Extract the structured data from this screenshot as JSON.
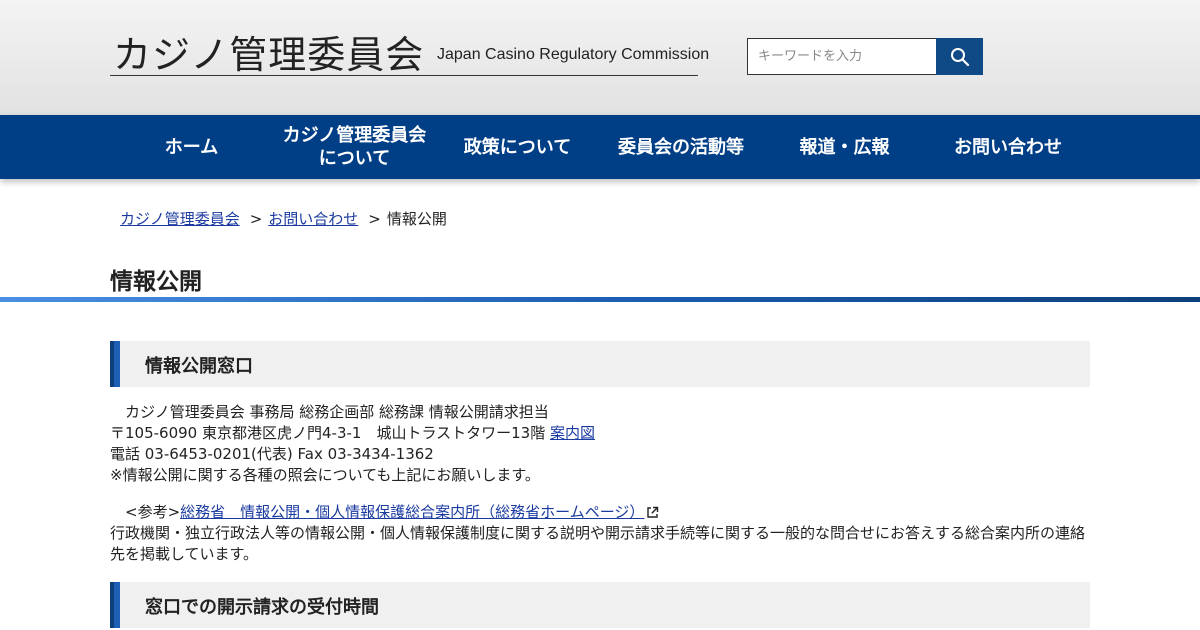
{
  "header": {
    "logo_ja": "カジノ管理委員会",
    "logo_en": "Japan Casino Regulatory Commission",
    "search_placeholder": "キーワードを入力"
  },
  "nav": [
    {
      "label": "ホーム"
    },
    {
      "label": "カジノ管理委員会\nについて"
    },
    {
      "label": "政策について"
    },
    {
      "label": "委員会の活動等"
    },
    {
      "label": "報道・広報"
    },
    {
      "label": "お問い合わせ"
    }
  ],
  "breadcrumb": {
    "home": "カジノ管理委員会",
    "sep": ">",
    "contact": "お問い合わせ",
    "current": "情報公開"
  },
  "page_title": "情報公開",
  "section1": {
    "heading": "情報公開窓口",
    "line1": "　カジノ管理委員会  事務局  総務企画部  総務課  情報公開請求担当",
    "line2": "〒105-6090 東京都港区虎ノ門4-3-1　城山トラストタワー13階 ",
    "map_link": "案内図",
    "line3": "電話 03-6453-0201(代表) Fax 03-3434-1362",
    "line4": "※情報公開に関する各種の照会についても上記にお願いします。",
    "ref_prefix": "　<参考>",
    "ref_link": "総務省　情報公開・個人情報保護総合案内所（総務省ホームページ）",
    "ref_desc": "行政機関・独立行政法人等の情報公開・個人情報保護制度に関する説明や開示請求手続等に関する一般的な問合せにお答えする総合案内所の連絡先を掲載しています。"
  },
  "section2": {
    "heading": "窓口での開示請求の受付時間"
  },
  "colors": {
    "nav_bg": "#003e86",
    "accent": "#1c5fb5",
    "link": "#1a3aa0"
  }
}
